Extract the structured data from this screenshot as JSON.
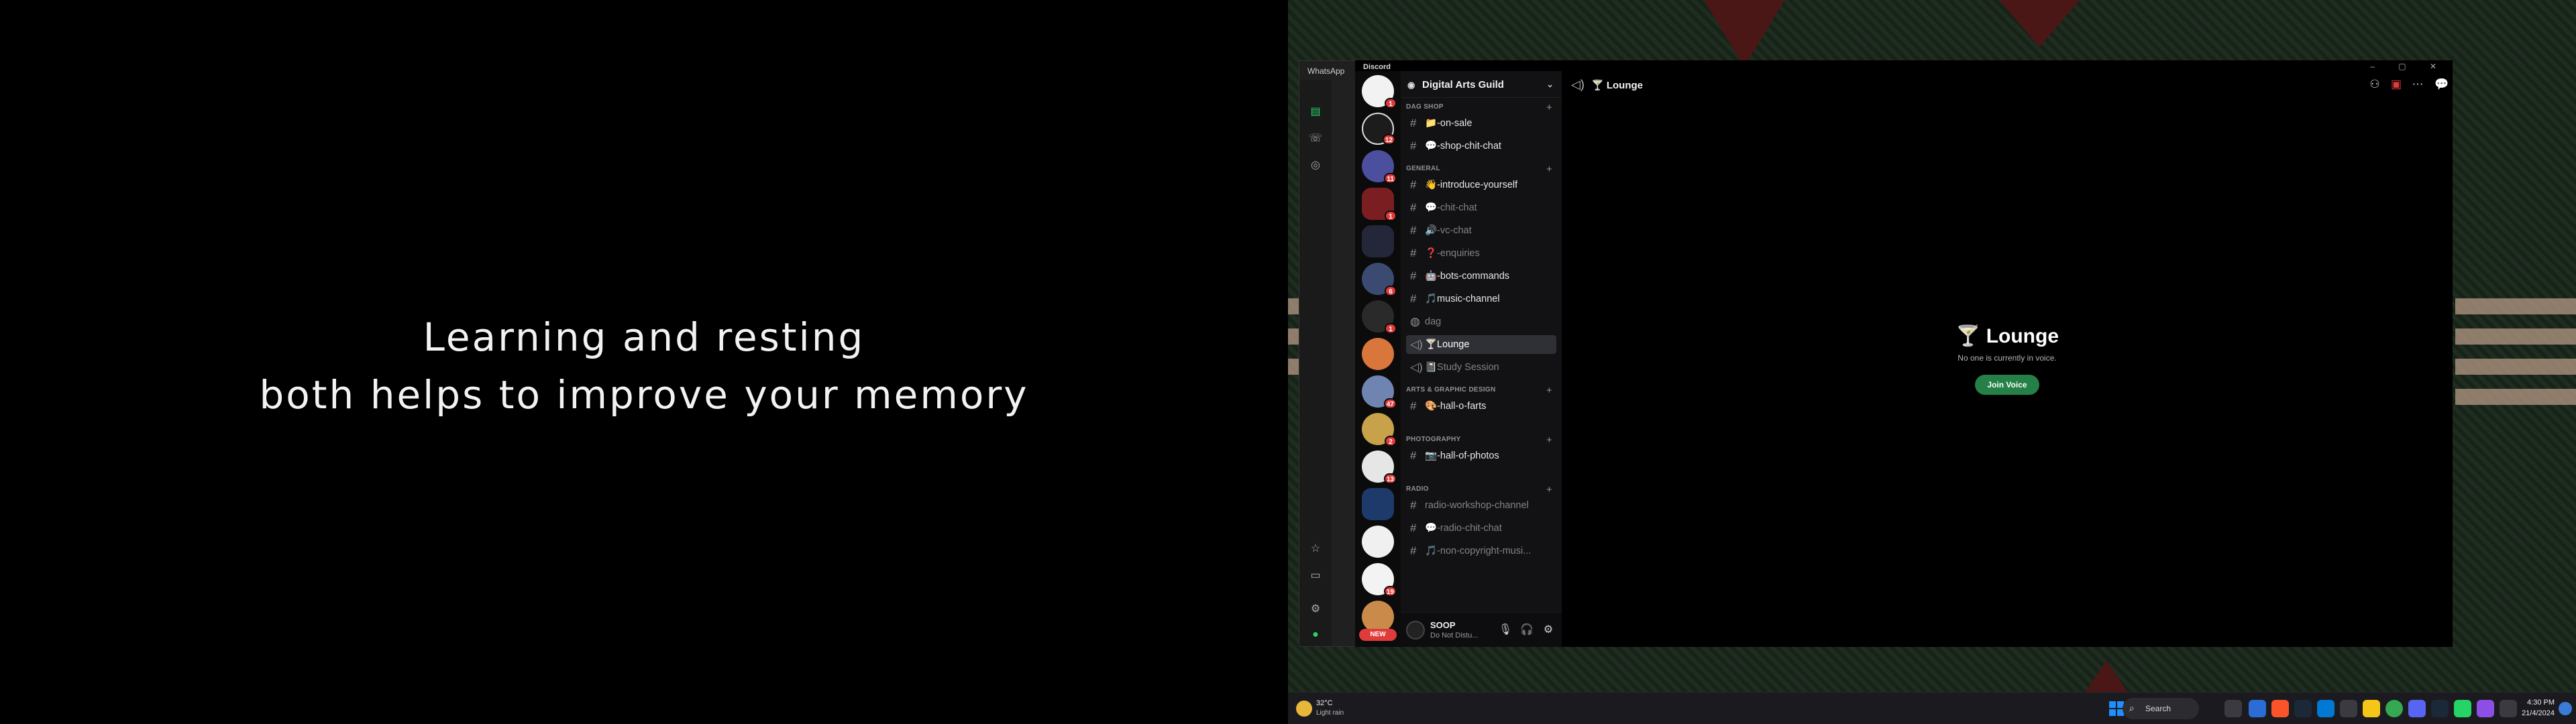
{
  "left_monitor": {
    "quote_line1": "Learning and resting",
    "quote_line2": "both helps to improve your memory"
  },
  "whatsapp": {
    "title": "WhatsApp",
    "window_controls": "– ▢ ✕",
    "rail_icons": [
      "chats-icon",
      "calls-icon",
      "status-icon",
      "starred-icon",
      "archive-icon",
      "settings-icon",
      "profile-icon"
    ]
  },
  "discord": {
    "app_title": "Discord",
    "window_controls": "– ▢ ✕",
    "server_badges": [
      "1",
      "12",
      "11",
      "1",
      "6",
      "1",
      "47",
      "2",
      "13",
      "19"
    ],
    "new_label": "NEW",
    "guild": {
      "name": "Digital Arts Guild",
      "icon": "guild-icon",
      "chevron": "⌄"
    },
    "categories": {
      "dag_shop": "DAG SHOP",
      "general": "GENERAL",
      "arts": "ARTS & GRAPHIC DESIGN",
      "photography": "PHOTOGRAPHY",
      "radio": "RADIO"
    },
    "channels": {
      "on_sale": "📁-on-sale",
      "shop_chit_chat": "💬-shop-chit-chat",
      "introduce": "👋-introduce-yourself",
      "chit_chat": "💬-chit-chat",
      "vc_chat": "🔊-vc-chat",
      "enquiries": "❓-enquiries",
      "bots": "🤖-bots-commands",
      "music": "🎵music-channel",
      "dag": "dag",
      "lounge": "🍸Lounge",
      "study": "📓Study Session",
      "hall_o_farts": "🎨-hall-o-farts",
      "hall_of_photos": "📷-hall-of-photos",
      "radio_workshop": "radio-workshop-channel",
      "radio_chit_chat": "💬-radio-chit-chat",
      "non_copyright": "🎵-non-copyright-musi..."
    },
    "user": {
      "name": "SOOP",
      "status": "Do Not Distu..."
    },
    "header": {
      "channel_title": "🍸 Lounge"
    },
    "voice": {
      "title": "🍸 Lounge",
      "subtitle": "No one is currently in voice.",
      "join_button": "Join Voice"
    }
  },
  "taskbar": {
    "weather_temp": "32°C",
    "weather_desc": "Light rain",
    "search_label": "Search",
    "time": "4:30 PM",
    "date": "21/4/2024"
  },
  "colors": {
    "join_green": "#248046",
    "badge_red": "#e03b3b",
    "discord_sidebar": "#121214"
  }
}
